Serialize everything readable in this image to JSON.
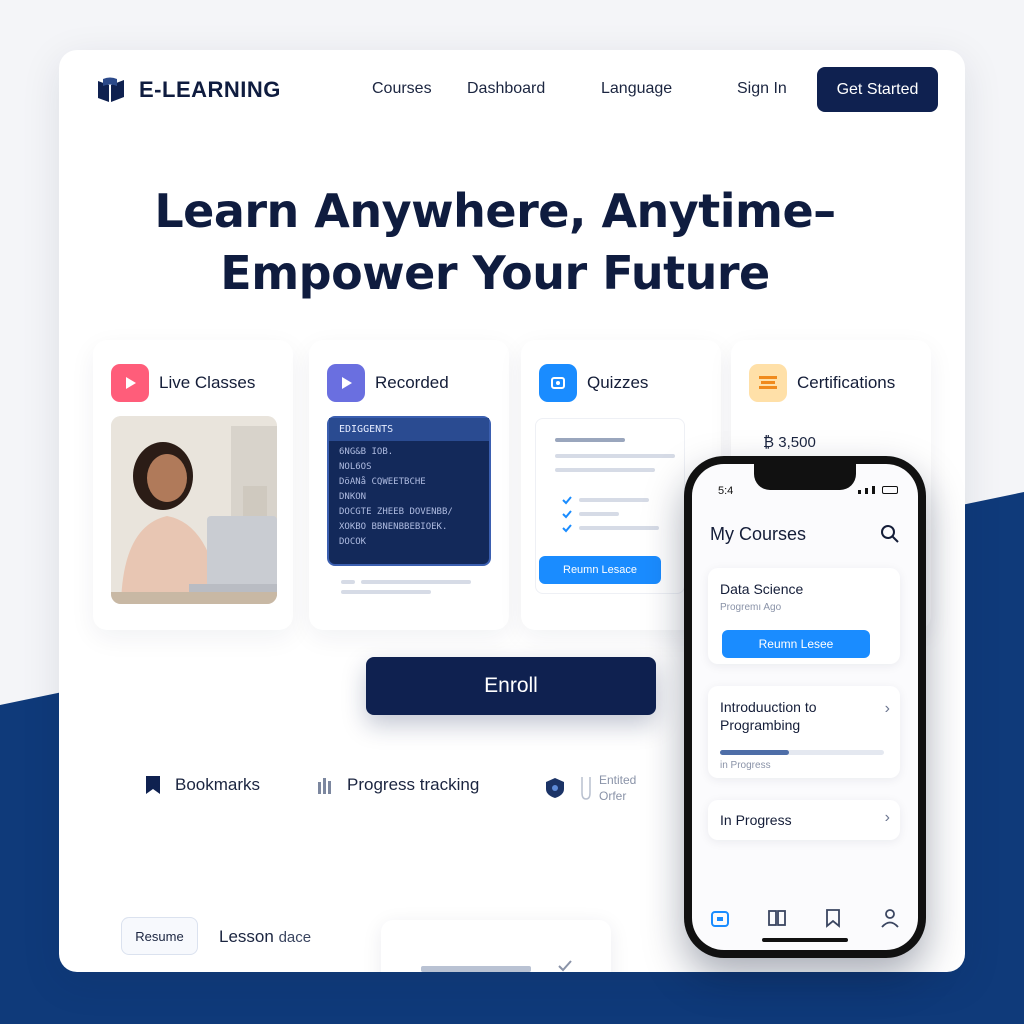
{
  "brand": {
    "name": "E-LEARNING",
    "color": "#0f2150",
    "icon": "book-logo-icon"
  },
  "nav": {
    "links": [
      "Courses",
      "Dashboard",
      "Language"
    ],
    "signin": "Sign In",
    "cta": "Get Started"
  },
  "hero": {
    "line1": "Learn Anywhere, Anytime–",
    "line2": "Empower Your Future"
  },
  "features": [
    {
      "title": "Live Classes",
      "icon": "play-icon",
      "color": "#ff5d7a"
    },
    {
      "title": "Recorded",
      "icon": "play-icon",
      "color": "#6a6fe0",
      "code_header": "EDIGGENTS",
      "code_lines": [
        "6NG&B IOB.",
        "NOL6OS",
        "DöANå  CQWEETBCHE",
        "DNKON",
        "DOCGTE  ZHEEB  DOVENBB/",
        "XOKBO  BBNENBBEBIOEK.",
        "DOCOK"
      ]
    },
    {
      "title": "Quizzes",
      "icon": "quiz-icon",
      "color": "#1a8cff",
      "button": "Reumn Lesace"
    },
    {
      "title": "Certifications",
      "icon": "certificate-icon",
      "color": "#ffa726",
      "value": "₿ 3,500"
    }
  ],
  "enroll": "Enroll",
  "bottom_features": {
    "bookmarks": "Bookmarks",
    "progress": "Progress tracking",
    "offer_line1": "Entited",
    "offer_line2": "Orfer"
  },
  "resume": {
    "chip": "Resume",
    "lesson": "Lesson",
    "lesson_suffix": "dace"
  },
  "phone": {
    "time": "5:4",
    "title": "My Courses",
    "card1": {
      "title": "Data Science",
      "subtitle": "Progremı Ago",
      "button": "Reumn Lesee"
    },
    "card2": {
      "title": "Introduuction to Programbing",
      "status": "in Progress",
      "progress": 0.42
    },
    "card3": {
      "title": "In Progress"
    },
    "tabs": [
      "home-icon",
      "book-icon",
      "bookmark-icon",
      "profile-icon"
    ],
    "accent": "#1a8cff"
  },
  "colors": {
    "navy": "#0f2150",
    "background_band": "#0f3a7a"
  }
}
